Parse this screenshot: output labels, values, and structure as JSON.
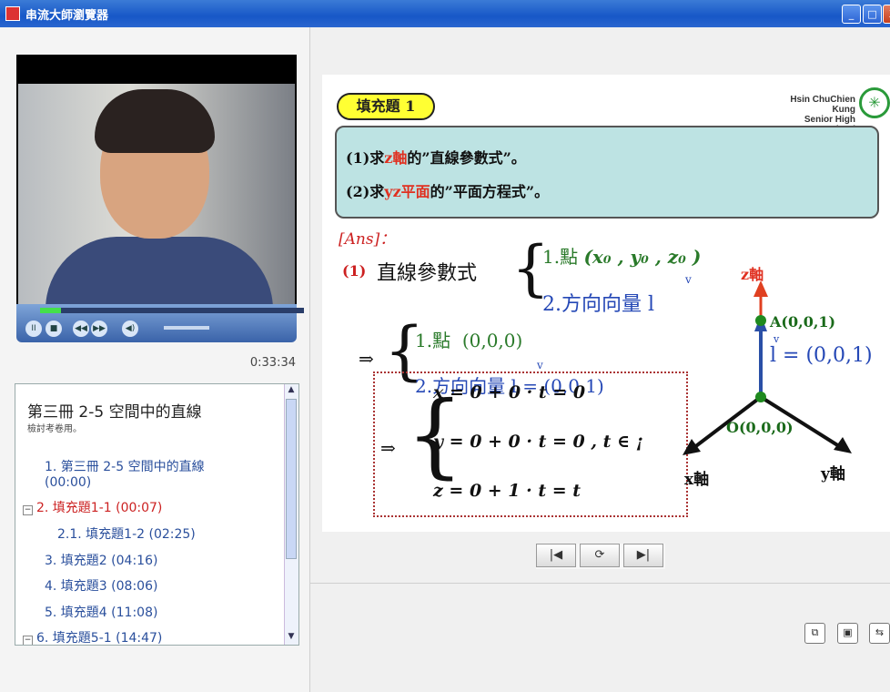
{
  "window": {
    "title": "串流大師瀏覽器",
    "min_label": "_",
    "max_label": "□",
    "close_label": "X"
  },
  "player": {
    "timecode": "0:33:34",
    "progress": 0.08,
    "buttons": {
      "pause": "II",
      "stop": "■",
      "prev": "◀◀",
      "next": "▶▶",
      "mute": "◀)"
    }
  },
  "toc": {
    "title": "第三冊 2-5 空間中的直線",
    "subtitle": "檢討考卷用。",
    "items": [
      {
        "label": "1. 第三冊 2-5 空間中的直線",
        "label2": "(00:00)",
        "active": false,
        "expander": ""
      },
      {
        "label": "2. 填充題1-1 (00:07)",
        "active": true,
        "expander": "−"
      },
      {
        "label": "2.1. 填充題1-2 (02:25)",
        "active": false,
        "expander": ""
      },
      {
        "label": "3. 填充題2 (04:16)",
        "active": false,
        "expander": ""
      },
      {
        "label": "4. 填充題3 (08:06)",
        "active": false,
        "expander": ""
      },
      {
        "label": "5. 填充題4 (11:08)",
        "active": false,
        "expander": ""
      },
      {
        "label": "6. 填充題5-1 (14:47)",
        "active": false,
        "expander": "−"
      }
    ]
  },
  "slide": {
    "badge": "填充題 1",
    "school_line1": "Hsin ChuChien Kung",
    "school_line2": "Senior High School",
    "logo": "✳",
    "q1_prefix": "(1)求",
    "q1_hl": "z軸",
    "q1_suffix": "的”直線參數式”。",
    "q2_prefix": "(2)求",
    "q2_hl": "yz平面",
    "q2_suffix": "的”平面方程式”。",
    "ans": "[Ans]：",
    "part1_label": "(1)",
    "part1_text": "直線參數式",
    "case1_point": "1.點",
    "case1_point_val": "(x₀ , y₀ , z₀ )",
    "case1_dir": "2.方向向量",
    "case1_dir_val": "l",
    "case1_vec_mark": "v",
    "implies": "⇒",
    "case2_point": "1.點",
    "case2_point_val": "(0,0,0)",
    "case2_dir": "2.方向向量",
    "case2_dir_val": "l = (0,0,1)",
    "case2_vec_mark": "v",
    "eq_x": "x = 0 + 0 · t = 0",
    "eq_y": "y = 0 + 0 · t = 0   , t ∈ ¡",
    "eq_z": "z = 0 + 1 · t = t",
    "axis_z": "z軸",
    "axis_x": "x軸",
    "axis_y": "y軸",
    "point_a": "A(0,0,1)",
    "point_o": "O(0,0,0)",
    "vec_label": "l = (0,0,1)",
    "vec_mark": "v"
  },
  "nav": {
    "prev": "|◀",
    "replay": "⟳",
    "next": "▶|"
  },
  "tools": {
    "btn1": "⧉",
    "btn2": "▣",
    "btn3": "⇆"
  }
}
